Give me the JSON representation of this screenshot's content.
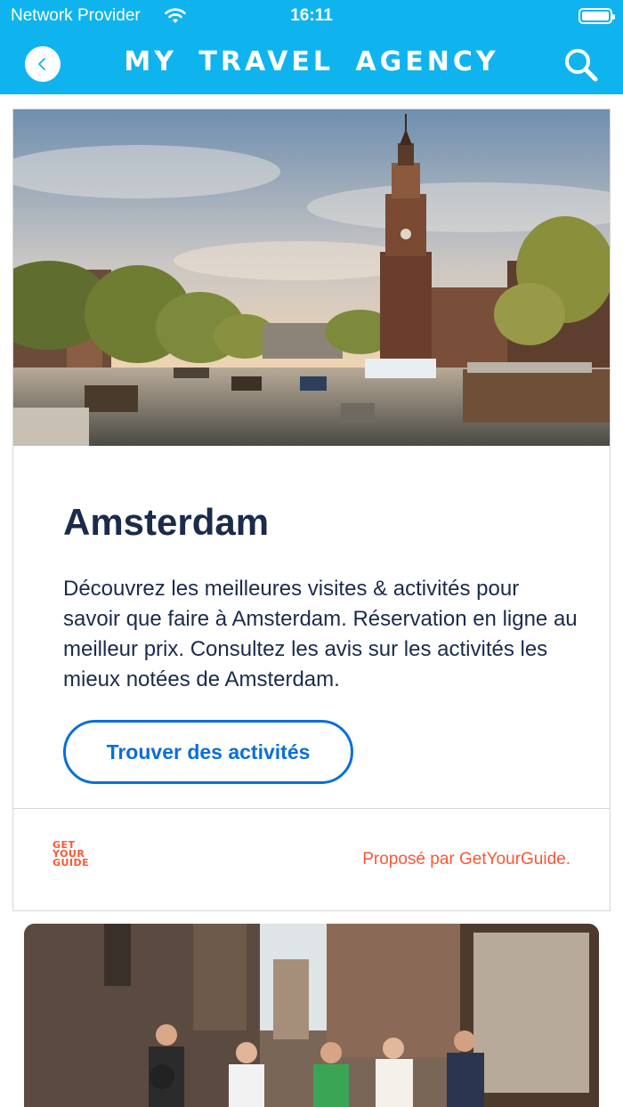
{
  "status_bar": {
    "carrier": "Network Provider",
    "time": "16:11"
  },
  "header": {
    "title": "MY TRAVEL AGENCY",
    "background_color": "#0fb4ef",
    "back_icon": "chevron-left-icon",
    "search_icon": "search-icon"
  },
  "card": {
    "title": "Amsterdam",
    "description": "Découvrez les meilleures visites & activités pour savoir que faire à Amsterdam. Réservation en ligne au meilleur prix. Consultez les avis sur les activités les mieux notées de Amsterdam.",
    "button_label": "Trouver des activités",
    "logo_lines": [
      "GET",
      "YOUR",
      "GUIDE"
    ],
    "provided_by": "Proposé par GetYourGuide.",
    "accent_color": "#0a6fd6",
    "brand_color": "#ff5533"
  }
}
